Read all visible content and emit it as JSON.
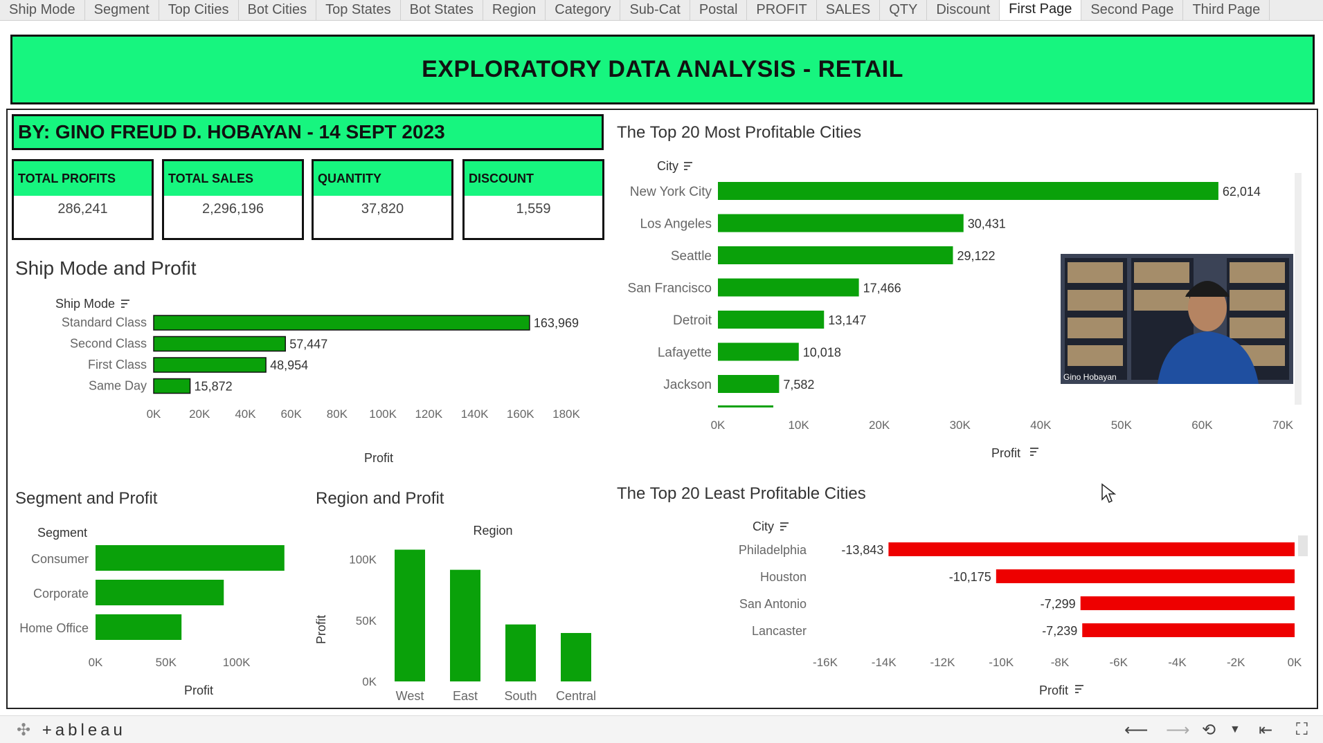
{
  "tabs": [
    "Ship Mode",
    "Segment",
    "Top Cities",
    "Bot Cities",
    "Top States",
    "Bot States",
    "Region",
    "Category",
    "Sub-Cat",
    "Postal",
    "PROFIT",
    "SALES",
    "QTY",
    "Discount",
    "First Page",
    "Second Page",
    "Third Page"
  ],
  "active_tab": "First Page",
  "banner_title": "EXPLORATORY DATA ANALYSIS - RETAIL",
  "author_line": "BY: GINO FREUD D. HOBAYAN  - 14 SEPT 2023",
  "kpis": [
    {
      "label": "TOTAL PROFITS",
      "value": "286,241"
    },
    {
      "label": "TOTAL SALES",
      "value": "2,296,196"
    },
    {
      "label": "QUANTITY",
      "value": "37,820"
    },
    {
      "label": "DISCOUNT",
      "value": "1,559"
    }
  ],
  "colors": {
    "accent_green": "#17f57f",
    "bar_green": "#0aa10a",
    "bar_red": "#ee0000",
    "border": "#111111"
  },
  "sections": {
    "ship_mode": "Ship Mode and Profit",
    "top_cities": "The Top 20 Most Profitable Cities",
    "segment": "Segment and Profit",
    "region": "Region and Profit",
    "least_cities": "The Top 20 Least Profitable Cities"
  },
  "video_overlay": {
    "name": "Gino Hobayan"
  },
  "footer": {
    "brand": "+ableau"
  },
  "chart_data": [
    {
      "id": "ship_mode",
      "type": "bar",
      "orientation": "horizontal",
      "dim_label": "Ship Mode",
      "categories": [
        "Standard Class",
        "Second Class",
        "First Class",
        "Same Day"
      ],
      "values": [
        163969,
        57447,
        48954,
        15872
      ],
      "data_labels": [
        "163,969",
        "57,447",
        "48,954",
        "15,872"
      ],
      "xlabel": "Profit",
      "xlim": [
        0,
        180000
      ],
      "ticks": [
        "0K",
        "20K",
        "40K",
        "60K",
        "80K",
        "100K",
        "120K",
        "140K",
        "160K",
        "180K"
      ]
    },
    {
      "id": "top_cities",
      "type": "bar",
      "orientation": "horizontal",
      "dim_label": "City",
      "categories": [
        "New York City",
        "Los Angeles",
        "Seattle",
        "San Francisco",
        "Detroit",
        "Lafayette",
        "Jackson"
      ],
      "values": [
        62014,
        30431,
        29122,
        17466,
        13147,
        10018,
        7582
      ],
      "data_labels": [
        "62,014",
        "30,431",
        "29,122",
        "17,466",
        "13,147",
        "10,018",
        "7,582"
      ],
      "xlabel": "Profit",
      "xlim": [
        0,
        70000
      ],
      "ticks": [
        "0K",
        "10K",
        "20K",
        "30K",
        "40K",
        "50K",
        "60K",
        "70K"
      ]
    },
    {
      "id": "segment",
      "type": "bar",
      "orientation": "horizontal",
      "dim_label": "Segment",
      "categories": [
        "Consumer",
        "Corporate",
        "Home Office"
      ],
      "values": [
        134000,
        91000,
        61000
      ],
      "xlabel": "Profit",
      "xlim": [
        0,
        140000
      ],
      "ticks": [
        "0K",
        "50K",
        "100K"
      ]
    },
    {
      "id": "region",
      "type": "bar",
      "orientation": "vertical",
      "dim_label": "Region",
      "categories": [
        "West",
        "East",
        "South",
        "Central"
      ],
      "values": [
        108000,
        91500,
        46700,
        39700
      ],
      "ylabel": "Profit",
      "ylim": [
        0,
        110000
      ],
      "ticks": [
        "0K",
        "50K",
        "100K"
      ]
    },
    {
      "id": "least_cities",
      "type": "bar",
      "orientation": "horizontal",
      "dim_label": "City",
      "categories": [
        "Philadelphia",
        "Houston",
        "San Antonio",
        "Lancaster"
      ],
      "values": [
        -13843,
        -10175,
        -7299,
        -7239
      ],
      "data_labels": [
        "-13,843",
        "-10,175",
        "-7,299",
        "-7,239"
      ],
      "xlabel": "Profit",
      "xlim": [
        -16000,
        0
      ],
      "ticks": [
        "-16K",
        "-14K",
        "-12K",
        "-10K",
        "-8K",
        "-6K",
        "-4K",
        "-2K",
        "0K"
      ]
    }
  ]
}
